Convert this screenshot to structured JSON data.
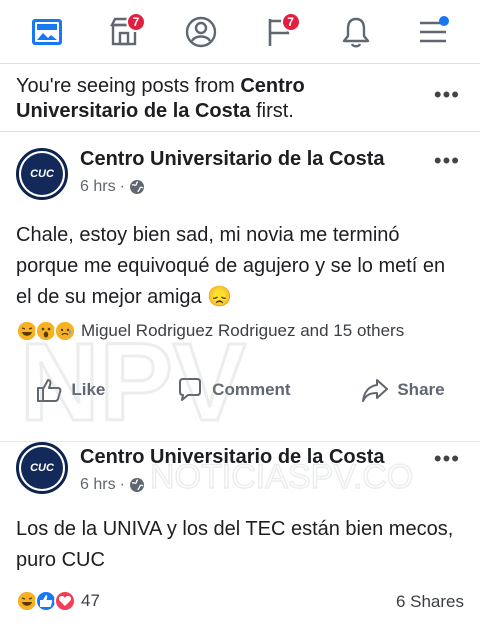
{
  "nav": {
    "items": [
      {
        "name": "news-feed",
        "badge": ""
      },
      {
        "name": "marketplace",
        "badge": "7"
      },
      {
        "name": "profile",
        "badge": ""
      },
      {
        "name": "pages",
        "badge": "7"
      },
      {
        "name": "notifications",
        "badge": ""
      },
      {
        "name": "menu",
        "badge": ""
      }
    ]
  },
  "banner": {
    "prefix": "You're seeing posts from ",
    "page_name": "Centro Universitario de la Costa",
    "suffix": " first."
  },
  "posts": [
    {
      "page_name": "Centro Universitario de la Costa",
      "avatar_text": "CUC",
      "time": "6 hrs",
      "audience": "globe-icon",
      "text": "Chale, estoy bien sad, mi novia me terminó porque me equivoqué de agujero y se lo metí en el de su mejor amiga",
      "emoji": "😞",
      "reactions_text": "Miguel Rodriguez Rodriguez and 15 others",
      "actions": {
        "like": "Like",
        "comment": "Comment",
        "share": "Share"
      }
    },
    {
      "page_name": "Centro Universitario de la Costa",
      "avatar_text": "CUC",
      "time": "6 hrs",
      "audience": "globe-icon",
      "text": "Los de la UNIVA y los del TEC están bien mecos, puro CUC",
      "reactions_count": "47",
      "shares": "6 Shares"
    }
  ],
  "watermark": {
    "text": "NOTICIASPV.CO"
  },
  "colors": {
    "accent": "#1877f2",
    "badge": "#e41e3f",
    "text": "#1c1e21",
    "muted": "#606770"
  }
}
